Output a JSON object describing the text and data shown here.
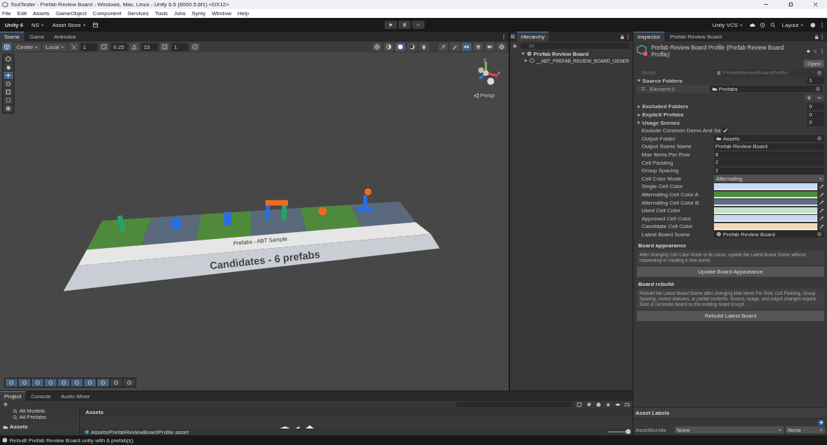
{
  "window": {
    "title": "ToolTester - Prefab Review Board - Windows, Mac, Linux - Unity 6.5 (6000.5.6f1) <DX12>"
  },
  "menu": [
    "File",
    "Edit",
    "Assets",
    "GameObject",
    "Component",
    "Services",
    "Tools",
    "Jobs",
    "Synty",
    "Window",
    "Help"
  ],
  "toolbar": {
    "account": "Unity 6",
    "user": "NS",
    "store": "Asset Store",
    "vcs": "Unity VCS",
    "layout": "Layout"
  },
  "scene_tabs": [
    {
      "label": "Scene",
      "selected": true
    },
    {
      "label": "Game",
      "selected": false
    },
    {
      "label": "Animator",
      "selected": false
    }
  ],
  "scene_toolbar": {
    "pivot": "Center",
    "space": "Local",
    "grid_size": "1",
    "move_snap": "0.25",
    "rotate_snap": "15",
    "scale_snap": "1"
  },
  "scene": {
    "camera": "Persp",
    "gizmo_axes": [
      "y",
      "x"
    ],
    "strip_label": "Prefabs - ABT Sample",
    "group_label": "Candidates - 6 prefabs",
    "cells": [
      {
        "color": "#4f8a3c"
      },
      {
        "color": "#5a6a7c"
      },
      {
        "color": "#4f8a3c"
      },
      {
        "color": "#5a6a7c"
      },
      {
        "color": "#4f8a3c"
      },
      {
        "color": "#5a6a7c"
      }
    ]
  },
  "hierarchy": {
    "title": "Hierarchy",
    "search_placeholder": "All",
    "items": [
      {
        "label": "Prefab Review Board",
        "expanded": true,
        "children": [
          {
            "label": "__ABT_PREFAB_REVIEW_BOARD_GENER",
            "expanded": false
          }
        ]
      }
    ]
  },
  "inspector": {
    "tabs": [
      {
        "label": "Inspector",
        "selected": true
      },
      {
        "label": "Prefab Review Board",
        "selected": false
      }
    ],
    "title": "Prefab Review Board Profile (Prefab Review Board Profile)",
    "open_button": "Open",
    "fields": [
      {
        "kind": "script_object",
        "label": "Script",
        "value": "PrefabReviewBoardProfile",
        "disabled": true
      },
      {
        "kind": "list",
        "label": "Source Folders",
        "count": "1",
        "expanded": true,
        "elements": [
          {
            "label": "Element 0",
            "value": "Prefabs"
          }
        ],
        "disabled": false
      },
      {
        "kind": "list",
        "label": "Excluded Folders",
        "count": "0",
        "expanded": false,
        "disabled": false
      },
      {
        "kind": "list",
        "label": "Explicit Prefabs",
        "count": "0",
        "expanded": false,
        "disabled": false
      },
      {
        "kind": "list",
        "label": "Usage Scenes",
        "count": "0",
        "expanded": false,
        "disabled": false
      },
      {
        "kind": "toggle",
        "label": "Exclude Common Demo And Sa",
        "checked": true,
        "disabled": false
      },
      {
        "kind": "folder_object",
        "label": "Output Folder",
        "value": "Assets",
        "disabled": false
      },
      {
        "kind": "text",
        "label": "Output Scene Name",
        "value": "Prefab Review Board",
        "disabled": false
      },
      {
        "kind": "text",
        "label": "Max Items Per Row",
        "value": "6",
        "disabled": false
      },
      {
        "kind": "text",
        "label": "Cell Padding",
        "value": "2",
        "disabled": false
      },
      {
        "kind": "text",
        "label": "Group Spacing",
        "value": "2",
        "disabled": false
      },
      {
        "kind": "dropdown",
        "label": "Cell Color Mode",
        "value": "Alternating",
        "disabled": false
      },
      {
        "kind": "color",
        "label": "Single Cell Color",
        "color": "#c6daf2",
        "disabled": false
      },
      {
        "kind": "color",
        "label": "Alternating Cell Color A",
        "color": "#4a8a3e",
        "disabled": false
      },
      {
        "kind": "color",
        "label": "Alternating Cell Color B",
        "color": "#5a6e82",
        "disabled": false
      },
      {
        "kind": "color",
        "label": "Used Cell Color",
        "color": "#c2e4c8",
        "disabled": false
      },
      {
        "kind": "color",
        "label": "Approved Cell Color",
        "color": "#c6daf2",
        "disabled": false
      },
      {
        "kind": "color",
        "label": "Candidate Cell Color",
        "color": "#f0dcb4",
        "disabled": false
      },
      {
        "kind": "scene_object",
        "label": "Latest Board Scene",
        "value": "Prefab Review Board",
        "disabled": false
      }
    ],
    "sections": [
      {
        "title": "Board appearance",
        "help": "After changing Cell Color Mode or its colors, update the Latest Board Scene without rescanning or creating a new scene.",
        "button": "Update Board Appearance"
      },
      {
        "title": "Board rebuild",
        "help": "Rebuild the Latest Board Scene after changing Max Items Per Row, Cell Padding, Group Spacing, review statuses, or prefab contents. Source, usage, and output changes require Scan & Generate Board so the existing board is kept.",
        "button": "Rebuild Latest Board"
      }
    ],
    "asset_labels": "Asset Labels",
    "asset_bundle": {
      "label": "AssetBundle",
      "values": [
        "None",
        "None"
      ]
    }
  },
  "project": {
    "tabs": [
      {
        "label": "Project",
        "selected": true
      },
      {
        "label": "Console",
        "selected": false
      },
      {
        "label": "Audio Mixer",
        "selected": false
      }
    ],
    "favorites": [
      "All Models",
      "All Prefabs"
    ],
    "root": "Assets",
    "breadcrumb": "Assets",
    "path": "Assets/PrefabReviewBoardProfile.asset",
    "visible_count": "23",
    "thumbnail_size": {
      "level": 1
    }
  },
  "status_bar": "Rebuilt Prefab Review Board.unity with 6 prefab(s)."
}
